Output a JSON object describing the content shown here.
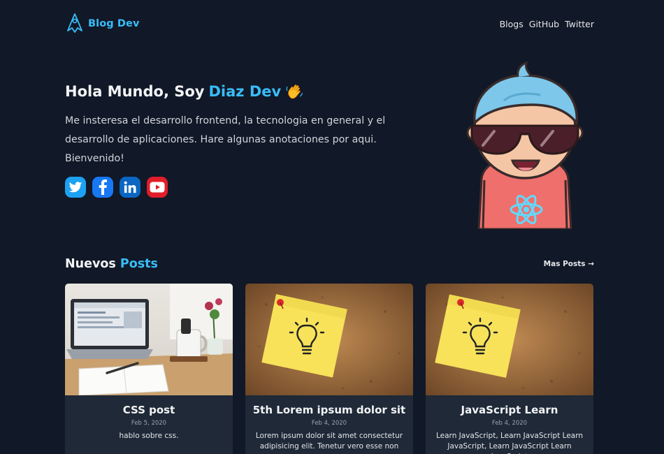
{
  "header": {
    "brand": "Blog Dev",
    "nav": [
      "Blogs",
      "GitHub",
      "Twitter"
    ]
  },
  "hero": {
    "greeting": "Hola Mundo, Soy",
    "name": "Diaz Dev",
    "description": "Me insteresa el desarrollo frontend, la tecnologia en general y el desarrollo de aplicaciones. Hare algunas anotaciones por aqui. Bienvenido!",
    "socials": [
      {
        "icon": "twitter-icon",
        "color": "#1da1f2"
      },
      {
        "icon": "facebook-icon",
        "color": "#1877f2"
      },
      {
        "icon": "linkedin-icon",
        "color": "#0a66c2"
      },
      {
        "icon": "youtube-icon",
        "color": "#ff0000"
      }
    ]
  },
  "posts": {
    "title_main": "Nuevos",
    "title_accent": "Posts",
    "more_link": "Mas Posts →",
    "items": [
      {
        "title": "CSS post",
        "date": "Feb 5, 2020",
        "excerpt": "hablo sobre css."
      },
      {
        "title": "5th Lorem ipsum dolor sit",
        "date": "Feb 4, 2020",
        "excerpt": "Lorem ipsum dolor sit amet consectetur adipisicing elit. Tenetur vero esse non"
      },
      {
        "title": "JavaScript Learn",
        "date": "Feb 4, 2020",
        "excerpt": "Learn JavaScript, Learn JavaScript Learn JavaScript, Learn JavaScript Learn JavaScript"
      }
    ]
  },
  "colors": {
    "background": "#111827",
    "accent": "#38bdf8",
    "card": "#1f2937"
  }
}
